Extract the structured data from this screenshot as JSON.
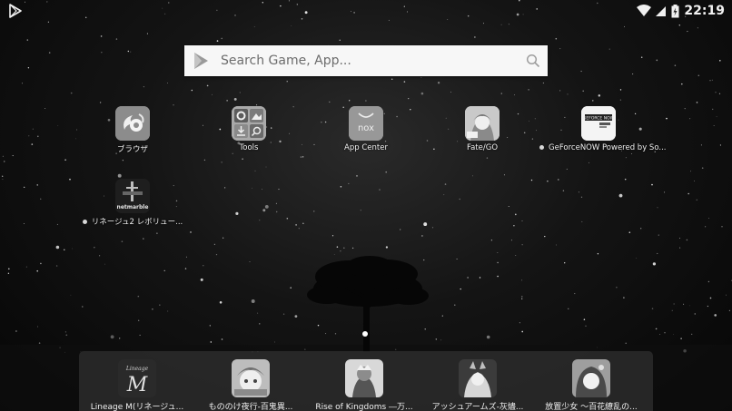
{
  "status_bar": {
    "time": "22:19",
    "icons": [
      "play-store-icon",
      "wifi-icon",
      "cell-signal-icon",
      "battery-charging-icon"
    ]
  },
  "search": {
    "placeholder": "Search Game, App...",
    "value": ""
  },
  "desktop": {
    "apps": [
      {
        "label": "ブラウザ",
        "icon": "browser-icon",
        "new": false
      },
      {
        "label": "Tools",
        "icon": "tools-folder-icon",
        "new": false
      },
      {
        "label": "App Center",
        "icon": "app-center-icon",
        "new": false
      },
      {
        "label": "Fate/GO",
        "icon": "fate-go-icon",
        "new": false
      },
      {
        "label": "GeForceNOW Powered by So...",
        "icon": "geforcenow-icon",
        "new": true
      },
      {
        "label": "リネージュ2 レボリュー...",
        "icon": "lineage2-revolution-icon",
        "new": true
      }
    ],
    "app_center_logo_text": "nox",
    "geforce_logo_text": "GEFORCE NOW",
    "netmarble_text": "netmarble"
  },
  "dock": {
    "apps": [
      {
        "label": "Lineage M(リネージュ...",
        "icon": "lineage-m-icon"
      },
      {
        "label": "もののけ夜行-百鬼異...",
        "icon": "mononoke-yakou-icon"
      },
      {
        "label": "Rise of Kingdoms ―万...",
        "icon": "rise-of-kingdoms-icon"
      },
      {
        "label": "アッシュアームズ-灰燼...",
        "icon": "ash-arms-icon"
      },
      {
        "label": "放置少女 〜百花繚乱の...",
        "icon": "houchi-shoujo-icon"
      }
    ],
    "lineage_logo_text": "Lineage",
    "lineage_logo_letter": "M"
  }
}
